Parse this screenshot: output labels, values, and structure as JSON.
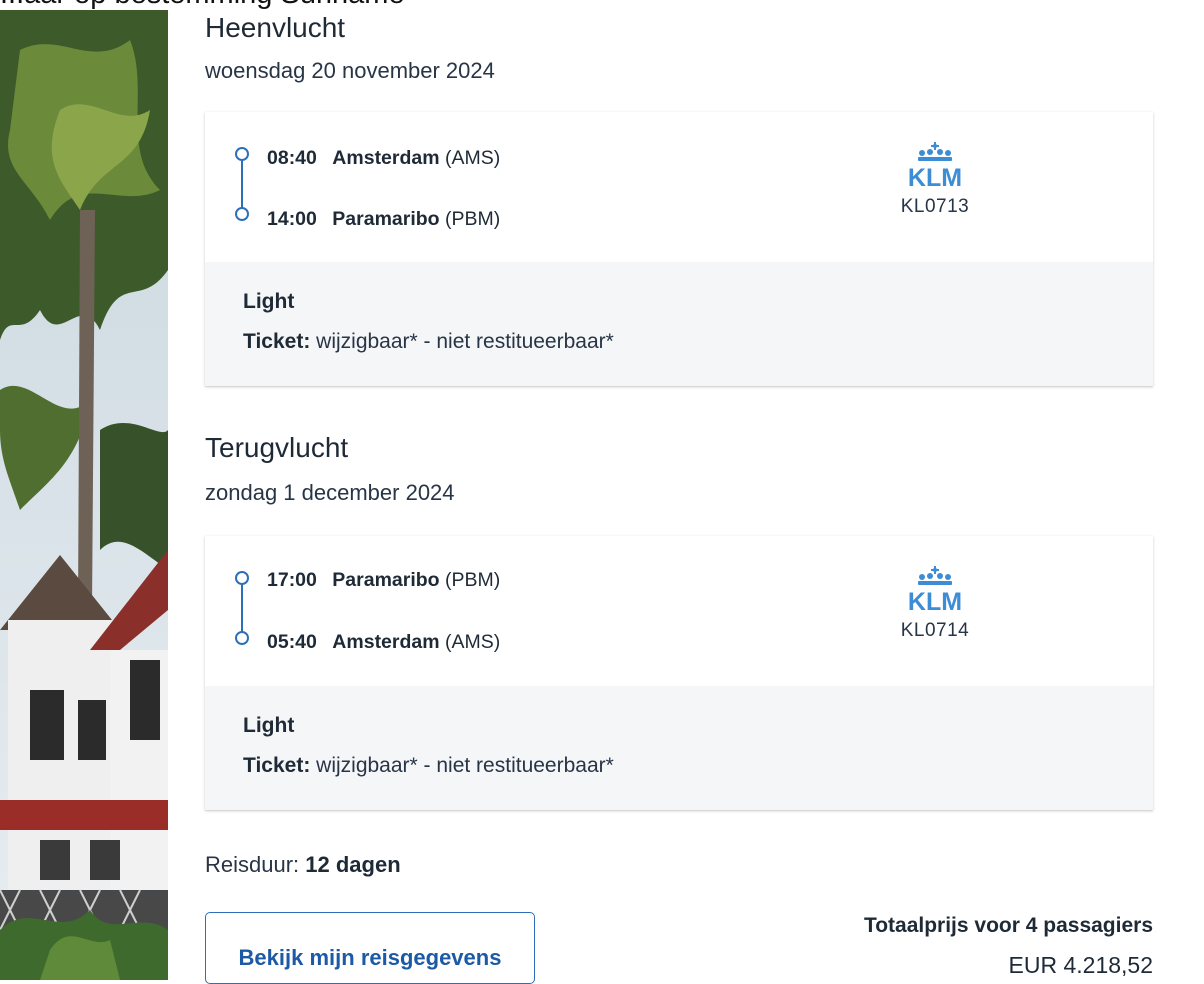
{
  "header": {
    "cutoff_text": "...aar op bestemming Suriname"
  },
  "outbound": {
    "title": "Heenvlucht",
    "date": "woensdag 20 november 2024",
    "departure": {
      "time": "08:40",
      "city": "Amsterdam",
      "code": "(AMS)"
    },
    "arrival": {
      "time": "14:00",
      "city": "Paramaribo",
      "code": "(PBM)"
    },
    "airline": "KLM",
    "flight_number": "KL0713",
    "fare_name": "Light",
    "ticket_label": "Ticket:",
    "ticket_conditions": "wijzigbaar* - niet restitueerbaar*"
  },
  "return": {
    "title": "Terugvlucht",
    "date": "zondag 1 december 2024",
    "departure": {
      "time": "17:00",
      "city": "Paramaribo",
      "code": "(PBM)"
    },
    "arrival": {
      "time": "05:40",
      "city": "Amsterdam",
      "code": "(AMS)"
    },
    "airline": "KLM",
    "flight_number": "KL0714",
    "fare_name": "Light",
    "ticket_label": "Ticket:",
    "ticket_conditions": "wijzigbaar* - niet restitueerbaar*"
  },
  "summary": {
    "duration_label": "Reisduur:",
    "duration_value": "12 dagen",
    "button_label": "Bekijk mijn reisgegevens",
    "price_label": "Totaalprijs voor 4 passagiers",
    "price_value": "EUR 4.218,52"
  },
  "colors": {
    "accent": "#2d6fb8",
    "klm_blue": "#3c8dd6",
    "card_footer": "#f5f6f8"
  }
}
